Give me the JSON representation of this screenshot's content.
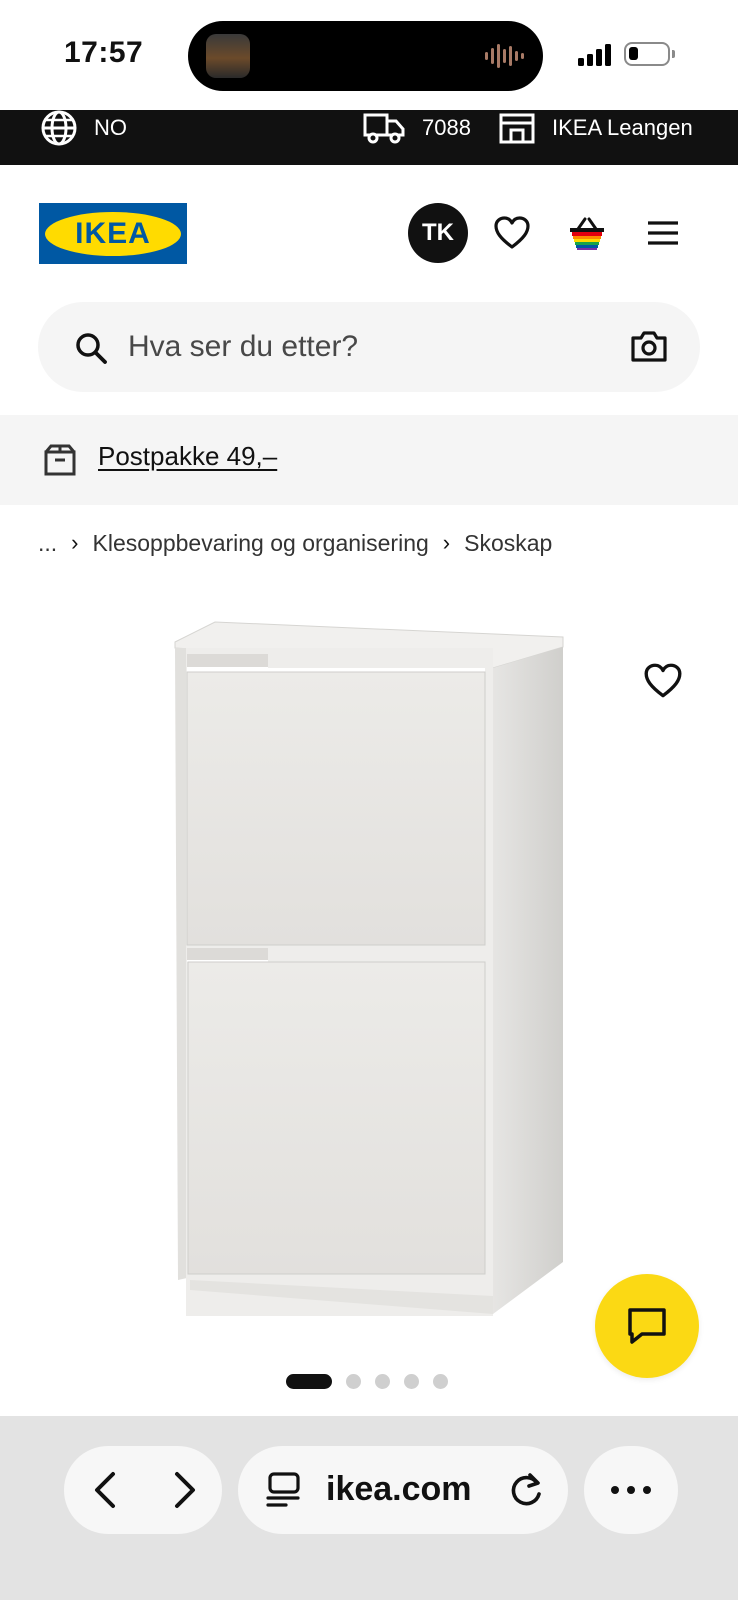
{
  "status_bar": {
    "time": "17:57"
  },
  "top_bar": {
    "language": "NO",
    "postcode": "7088",
    "store": "IKEA Leangen"
  },
  "header": {
    "logo_text": "IKEA",
    "avatar_initials": "TK"
  },
  "search": {
    "placeholder": "Hva ser du etter?"
  },
  "promo": {
    "text": "Postpakke 49,–"
  },
  "breadcrumb": {
    "ellipsis": "...",
    "items": [
      "Klesoppbevaring og organisering",
      "Skoskap"
    ]
  },
  "gallery": {
    "image_count": 5,
    "active_index": 0
  },
  "browser": {
    "url": "ikea.com"
  },
  "colors": {
    "ikea_blue": "#0058a3",
    "ikea_yellow": "#ffdb00",
    "chat_yellow": "#fbd914"
  },
  "icons": [
    "globe-icon",
    "truck-icon",
    "store-icon",
    "heart-icon",
    "basket-icon",
    "menu-icon",
    "search-icon",
    "camera-icon",
    "parcel-icon",
    "chat-icon",
    "back-icon",
    "forward-icon",
    "tabs-icon",
    "reload-icon",
    "more-icon"
  ]
}
